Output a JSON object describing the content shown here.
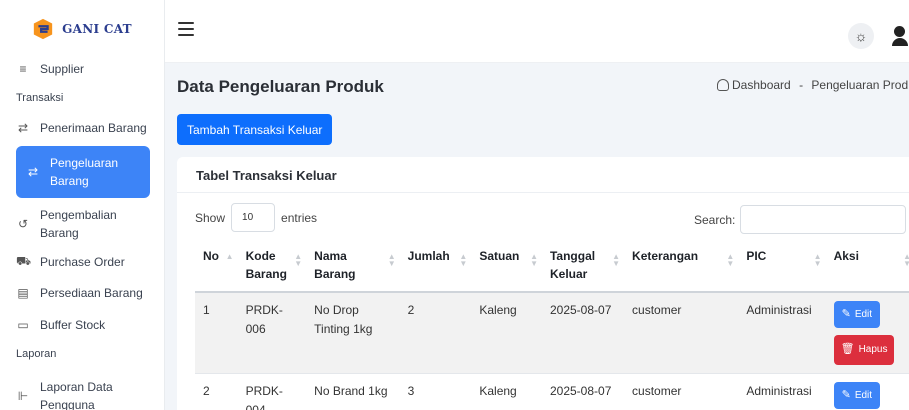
{
  "brand": {
    "name": "GANI CAT"
  },
  "sidebar": {
    "items": [
      {
        "label": "Supplier",
        "icon": "list-icon"
      },
      {
        "section": "Transaksi"
      },
      {
        "label": "Penerimaan Barang",
        "icon": "swap-icon"
      },
      {
        "label": "Pengeluaran Barang",
        "icon": "swap-icon",
        "active": true
      },
      {
        "label": "Pengembalian Barang",
        "icon": "return-icon"
      },
      {
        "label": "Purchase Order",
        "icon": "cart-icon"
      },
      {
        "label": "Persediaan Barang",
        "icon": "box-icon"
      },
      {
        "label": "Buffer Stock",
        "icon": "archive-icon"
      },
      {
        "section": "Laporan"
      },
      {
        "label": "Laporan Data Pengguna",
        "icon": "report-icon"
      }
    ]
  },
  "header": {
    "page_title": "Data Pengeluaran Produk"
  },
  "breadcrumb": {
    "home": "Dashboard",
    "sep": "-",
    "current": "Pengeluaran Prod"
  },
  "actions": {
    "add_label": "Tambah Transaksi Keluar"
  },
  "table_card": {
    "title": "Tabel Transaksi Keluar",
    "show_label": "Show",
    "entries_value": "10",
    "entries_label": "entries",
    "search_label": "Search:",
    "columns": [
      "No",
      "Kode Barang",
      "Nama Barang",
      "Jumlah",
      "Satuan",
      "Tanggal Keluar",
      "Keterangan",
      "PIC",
      "Aksi"
    ],
    "rows": [
      {
        "no": "1",
        "kode": "PRDK-006",
        "nama": "No Drop Tinting 1kg",
        "jumlah": "2",
        "satuan": "Kaleng",
        "tanggal": "2025-08-07",
        "keterangan": "customer",
        "pic": "Administrasi"
      },
      {
        "no": "2",
        "kode": "PRDK-004",
        "nama": "No Brand 1kg",
        "jumlah": "3",
        "satuan": "Kaleng",
        "tanggal": "2025-08-07",
        "keterangan": "customer",
        "pic": "Administrasi"
      }
    ],
    "edit_label": "Edit",
    "delete_label": "Hapus"
  },
  "colors": {
    "primary": "#0d6efd",
    "active_nav": "#3d84f7",
    "danger": "#dc2f3d"
  }
}
